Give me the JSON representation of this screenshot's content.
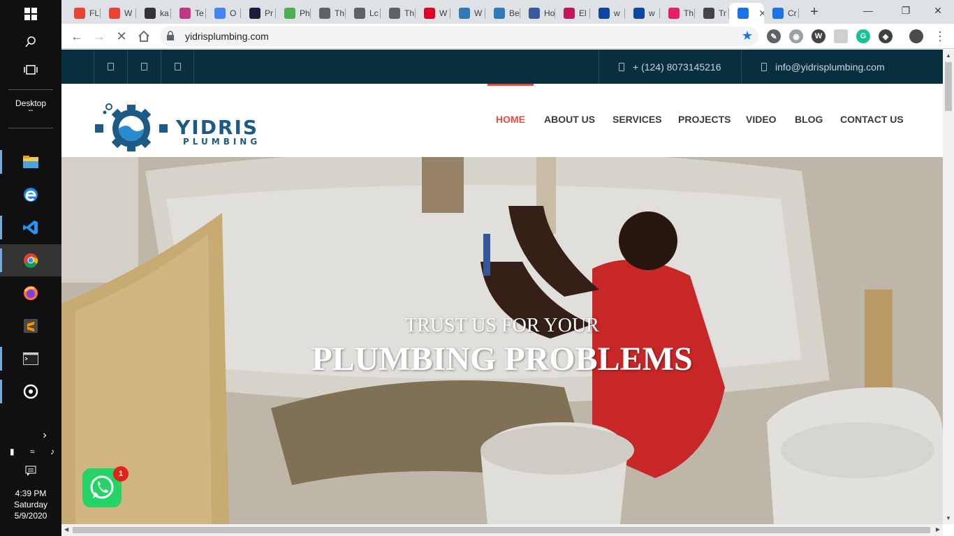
{
  "taskbar": {
    "desktop_label": "Desktop",
    "clock": {
      "time": "4:39 PM",
      "day": "Saturday",
      "date": "5/9/2020"
    }
  },
  "browser": {
    "tabs": [
      {
        "label": "FL",
        "icon": "gmail-icon",
        "color": "#ea4335"
      },
      {
        "label": "W",
        "icon": "gmail-icon",
        "color": "#ea4335"
      },
      {
        "label": "ka",
        "icon": "kanban-icon",
        "color": "#333333"
      },
      {
        "label": "Te",
        "icon": "instagram-icon",
        "color": "#c13584"
      },
      {
        "label": "O",
        "icon": "play-icon",
        "color": "#4285f4"
      },
      {
        "label": "Pr",
        "icon": "code-icon",
        "color": "#1b1f3b"
      },
      {
        "label": "Ph",
        "icon": "w3-icon",
        "color": "#4caf50"
      },
      {
        "label": "Th",
        "icon": "globe-icon",
        "color": "#5f6368"
      },
      {
        "label": "Lc",
        "icon": "globe-icon",
        "color": "#5f6368"
      },
      {
        "label": "Th",
        "icon": "globe-icon",
        "color": "#5f6368"
      },
      {
        "label": "W",
        "icon": "pinterest-icon",
        "color": "#e60023"
      },
      {
        "label": "W",
        "icon": "site-icon",
        "color": "#2e7ab8"
      },
      {
        "label": "Be",
        "icon": "site-icon",
        "color": "#2e7ab8"
      },
      {
        "label": "Ho",
        "icon": "frame-icon",
        "color": "#3a5a99"
      },
      {
        "label": "El",
        "icon": "et-icon",
        "color": "#c2185b"
      },
      {
        "label": "w",
        "icon": "m-icon",
        "color": "#0d47a1"
      },
      {
        "label": "w",
        "icon": "m-icon",
        "color": "#0d47a1"
      },
      {
        "label": "Th",
        "icon": "star-icon",
        "color": "#e91e63"
      },
      {
        "label": "Tr",
        "icon": "linux-icon",
        "color": "#444444"
      },
      {
        "label": "",
        "icon": "loading-icon",
        "color": "#1a73e8",
        "active": true
      },
      {
        "label": "Cr",
        "icon": "loader-icon",
        "color": "#1a73e8"
      }
    ],
    "url": "yidrisplumbing.com"
  },
  "site": {
    "phone": "+ (124) 8073145216",
    "email": "info@yidrisplumbing.com",
    "logo": {
      "title": "YIDRIS",
      "subtitle": "PLUMBING"
    },
    "menu": [
      "HOME",
      "ABOUT US",
      "SERVICES",
      "PROJECTS",
      "VIDEO",
      "BLOG",
      "CONTACT US"
    ],
    "active_menu": "HOME",
    "hero": {
      "subtitle": "TRUST US FOR YOUR",
      "title": "PLUMBING PROBLEMS"
    },
    "whatsapp_badge": "1"
  },
  "colors": {
    "topbar": "#072f3e",
    "accent": "#e74c3c",
    "brand": "#1d5b86",
    "whatsapp": "#25d366"
  }
}
